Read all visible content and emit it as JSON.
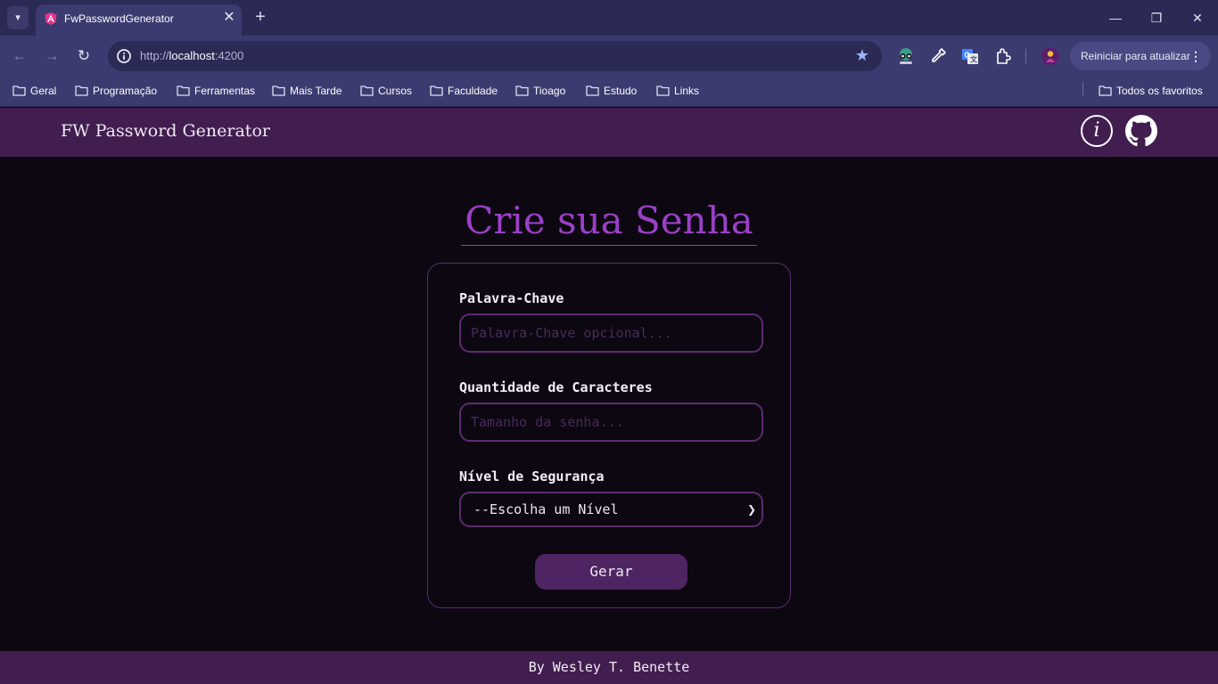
{
  "browser": {
    "tab": {
      "title": "FwPasswordGenerator",
      "close": "✕"
    },
    "new_tab": "+",
    "window": {
      "minimize": "—",
      "maximize": "❐",
      "close": "✕"
    },
    "nav": {
      "back": "←",
      "forward": "→",
      "reload": "↻"
    },
    "url": {
      "scheme": "http://",
      "host": "localhost",
      "port": ":4200"
    },
    "bookmark_star": "★",
    "restart": {
      "label": "Reiniciar para atualizar",
      "menu": "⋮"
    },
    "bookmarks": [
      "Geral",
      "Programação",
      "Ferramentas",
      "Mais Tarde",
      "Cursos",
      "Faculdade",
      "Tioago",
      "Estudo",
      "Links"
    ],
    "all_bookmarks": "Todos os favoritos"
  },
  "app": {
    "title": "FW Password Generator",
    "info_icon": "i",
    "heading": "Crie sua Senha",
    "form": {
      "keyword_label": "Palavra-Chave",
      "keyword_placeholder": "Palavra-Chave opcional...",
      "length_label": "Quantidade de Caracteres",
      "length_placeholder": "Tamanho da senha...",
      "level_label": "Nível de Segurança",
      "level_selected": "--Escolha um Nível",
      "submit": "Gerar"
    },
    "footer": "By Wesley T. Benette"
  },
  "colors": {
    "accent": "#9b3fc7",
    "header_bg": "#421d4f",
    "page_bg": "#0c0711",
    "border": "#5b2d6e",
    "button_bg": "#4e2462",
    "chrome_tab": "#3c3b70",
    "chrome_frame": "#2b2a55"
  },
  "icons": [
    "angular-favicon-icon",
    "info-icon",
    "github-icon",
    "folder-icon",
    "star-icon",
    "site-info-icon",
    "eyedropper-icon",
    "translate-icon",
    "extensions-icon",
    "profile-icon",
    "spy-extension-icon"
  ]
}
